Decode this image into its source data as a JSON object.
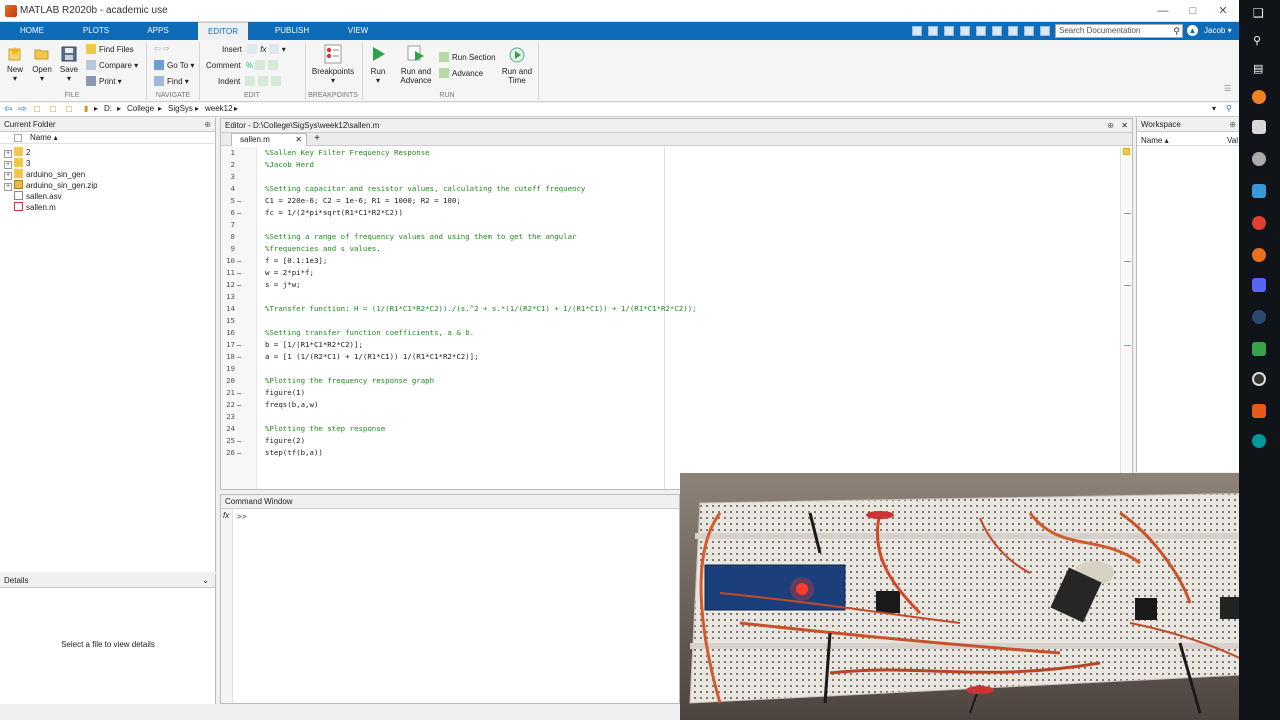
{
  "window": {
    "title": "MATLAB R2020b - academic use"
  },
  "ribbon": {
    "tabs": [
      "HOME",
      "PLOTS",
      "APPS",
      "EDITOR",
      "PUBLISH",
      "VIEW"
    ],
    "active_tab": "EDITOR",
    "search_placeholder": "Search Documentation",
    "user": "Jacob",
    "file_group": {
      "label": "FILE",
      "new": "New",
      "open": "Open",
      "save": "Save"
    },
    "navigate_group": {
      "label": "NAVIGATE",
      "find_files": "Find Files",
      "compare": "Compare",
      "print": "Print",
      "go_to": "Go To",
      "find": "Find"
    },
    "edit_group": {
      "label": "EDIT",
      "insert": "Insert",
      "comment": "Comment",
      "indent": "Indent"
    },
    "breakpoints_group": {
      "label": "BREAKPOINTS",
      "breakpoints": "Breakpoints"
    },
    "run_group": {
      "label": "RUN",
      "run": "Run",
      "run_and_advance_1": "Run and",
      "run_and_advance_2": "Advance",
      "run_section": "Run Section",
      "advance": "Advance",
      "run_and_time_1": "Run and",
      "run_and_time_2": "Time"
    }
  },
  "address": {
    "path": [
      "D:",
      "College",
      "SigSys",
      "week12"
    ]
  },
  "current_folder": {
    "title": "Current Folder",
    "column": "Name ▴",
    "items": [
      {
        "name": "2",
        "type": "folder"
      },
      {
        "name": "3",
        "type": "folder"
      },
      {
        "name": "arduino_sin_gen",
        "type": "folder"
      },
      {
        "name": "arduino_sin_gen.zip",
        "type": "zip"
      },
      {
        "name": "sallen.asv",
        "type": "file"
      },
      {
        "name": "sallen.m",
        "type": "mfile"
      }
    ]
  },
  "details": {
    "title": "Details",
    "empty_text": "Select a file to view details"
  },
  "editor": {
    "header": "Editor - D:\\College\\SigSys\\week12\\sallen.m",
    "tab": "sallen.m",
    "lines": [
      {
        "n": "1",
        "dash": "",
        "text": "%Sallen Key Filter Frequency Response",
        "comment": true
      },
      {
        "n": "2",
        "dash": "",
        "text": "%Jacob Herd",
        "comment": true
      },
      {
        "n": "3",
        "dash": "",
        "text": "",
        "comment": false
      },
      {
        "n": "4",
        "dash": "",
        "text": "%Setting capacitor and resistor values, calculating the cutoff frequency",
        "comment": true
      },
      {
        "n": "5",
        "dash": "—",
        "text": "C1 = 220e-6; C2 = 1e-6; R1 = 1000; R2 = 100;",
        "comment": false
      },
      {
        "n": "6",
        "dash": "—",
        "text": "fc = 1/(2*pi*sqrt(R1*C1*R2*C2))",
        "comment": false
      },
      {
        "n": "7",
        "dash": "",
        "text": "",
        "comment": false
      },
      {
        "n": "8",
        "dash": "",
        "text": "%Setting a range of frequency values and using them to get the angular",
        "comment": true
      },
      {
        "n": "9",
        "dash": "",
        "text": "%frequencies and s values.",
        "comment": true
      },
      {
        "n": "10",
        "dash": "—",
        "text": "f = [0.1:1e3];",
        "comment": false
      },
      {
        "n": "11",
        "dash": "—",
        "text": "w = 2*pi*f;",
        "comment": false
      },
      {
        "n": "12",
        "dash": "—",
        "text": "s = j*w;",
        "comment": false
      },
      {
        "n": "13",
        "dash": "",
        "text": "",
        "comment": false
      },
      {
        "n": "14",
        "dash": "",
        "text": "%Transfer function: H = (1/(R1*C1*R2*C2))./(s.^2 + s.*(1/(R2*C1) + 1/(R1*C1)) + 1/(R1*C1*R2*C2));",
        "comment": true
      },
      {
        "n": "15",
        "dash": "",
        "text": "",
        "comment": false
      },
      {
        "n": "16",
        "dash": "",
        "text": "%Setting transfer function coefficients, a & b.",
        "comment": true
      },
      {
        "n": "17",
        "dash": "—",
        "text": "b = [1/(R1*C1*R2*C2)];",
        "comment": false
      },
      {
        "n": "18",
        "dash": "—",
        "text": "a = [1 (1/(R2*C1) + 1/(R1*C1)) 1/(R1*C1*R2*C2)];",
        "comment": false
      },
      {
        "n": "19",
        "dash": "",
        "text": "",
        "comment": false
      },
      {
        "n": "20",
        "dash": "",
        "text": "%Plotting the frequency response graph",
        "comment": true
      },
      {
        "n": "21",
        "dash": "—",
        "text": "figure(1)",
        "comment": false
      },
      {
        "n": "22",
        "dash": "—",
        "text": "freqs(b,a,w)",
        "comment": false
      },
      {
        "n": "23",
        "dash": "",
        "text": "",
        "comment": false
      },
      {
        "n": "24",
        "dash": "",
        "text": "%Plotting the step response",
        "comment": true
      },
      {
        "n": "25",
        "dash": "—",
        "text": "figure(2)",
        "comment": false
      },
      {
        "n": "26",
        "dash": "—",
        "text": "step(tf(b,a))",
        "comment": false
      }
    ]
  },
  "workspace": {
    "title": "Workspace",
    "col_name": "Name ▴",
    "col_value": "Val"
  },
  "command_window": {
    "title": "Command Window",
    "fx": "fx",
    "prompt": ">>"
  },
  "colors": {
    "ribbon_blue": "#0e6bb8",
    "comment_green": "#228b22",
    "marker_orange": "#e8882a"
  }
}
